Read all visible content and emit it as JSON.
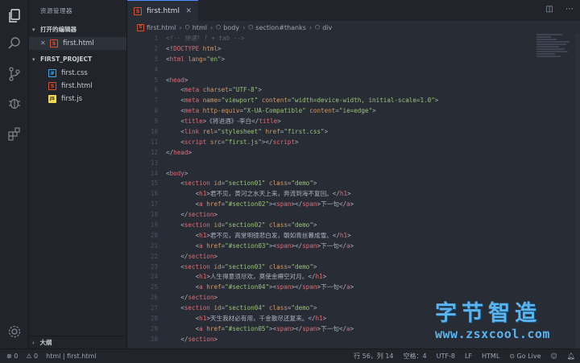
{
  "sidebar": {
    "title": "资源管理器",
    "open_editors": {
      "label": "打开的编辑器",
      "items": [
        {
          "close": "✕",
          "icon": "5",
          "name": "first.html"
        }
      ]
    },
    "project": {
      "label": "FIRST_PROJECT",
      "items": [
        {
          "icon": "#",
          "type": "css",
          "name": "first.css"
        },
        {
          "icon": "5",
          "type": "html",
          "name": "first.html"
        },
        {
          "icon": "JS",
          "type": "js",
          "name": "first.js"
        }
      ]
    },
    "outline_label": "大纲"
  },
  "tabs": [
    {
      "label": "first.html",
      "icon": "5",
      "close": "✕"
    }
  ],
  "breadcrumb": [
    "first.html",
    "html",
    "body",
    "section#thanks",
    "div"
  ],
  "editor": {
    "line_numbers": [
      "1",
      "2",
      "3",
      "4",
      "5",
      "6",
      "7",
      "8",
      "9",
      "10",
      "11",
      "12",
      "13",
      "14",
      "15",
      "16",
      "17",
      "18",
      "19",
      "20",
      "21",
      "22",
      "23",
      "24",
      "25",
      "26",
      "27",
      "28",
      "29",
      "30"
    ],
    "lines": [
      [
        {
          "c": "t-cmt",
          "t": "<!-- 快速! ! + tab -->"
        }
      ],
      [
        {
          "c": "t-punc",
          "t": "<!"
        },
        {
          "c": "t-tag",
          "t": "DOCTYPE"
        },
        {
          "c": "t-attr",
          "t": " html"
        },
        {
          "c": "t-punc",
          "t": ">"
        }
      ],
      [
        {
          "c": "t-punc",
          "t": "<"
        },
        {
          "c": "t-tag",
          "t": "html"
        },
        {
          "c": "t-attr",
          "t": " lang"
        },
        {
          "c": "t-punc",
          "t": "="
        },
        {
          "c": "t-str",
          "t": "\"en\""
        },
        {
          "c": "t-punc",
          "t": ">"
        }
      ],
      [],
      [
        {
          "c": "t-punc",
          "t": "<"
        },
        {
          "c": "t-tag",
          "t": "head"
        },
        {
          "c": "t-punc",
          "t": ">"
        }
      ],
      [
        {
          "c": "t-punc",
          "t": "    <"
        },
        {
          "c": "t-tag",
          "t": "meta"
        },
        {
          "c": "t-attr",
          "t": " charset"
        },
        {
          "c": "t-punc",
          "t": "="
        },
        {
          "c": "t-str",
          "t": "\"UTF-8\""
        },
        {
          "c": "t-punc",
          "t": ">"
        }
      ],
      [
        {
          "c": "t-punc",
          "t": "    <"
        },
        {
          "c": "t-tag",
          "t": "meta"
        },
        {
          "c": "t-attr",
          "t": " name"
        },
        {
          "c": "t-punc",
          "t": "="
        },
        {
          "c": "t-str",
          "t": "\"viewport\""
        },
        {
          "c": "t-attr",
          "t": " content"
        },
        {
          "c": "t-punc",
          "t": "="
        },
        {
          "c": "t-str",
          "t": "\"width=device-width, initial-scale=1.0\""
        },
        {
          "c": "t-punc",
          "t": ">"
        }
      ],
      [
        {
          "c": "t-punc",
          "t": "    <"
        },
        {
          "c": "t-tag",
          "t": "meta"
        },
        {
          "c": "t-attr",
          "t": " http-equiv"
        },
        {
          "c": "t-punc",
          "t": "="
        },
        {
          "c": "t-str",
          "t": "\"X-UA-Compatible\""
        },
        {
          "c": "t-attr",
          "t": " content"
        },
        {
          "c": "t-punc",
          "t": "="
        },
        {
          "c": "t-str",
          "t": "\"ie=edge\""
        },
        {
          "c": "t-punc",
          "t": ">"
        }
      ],
      [
        {
          "c": "t-punc",
          "t": "    <"
        },
        {
          "c": "t-tag",
          "t": "title"
        },
        {
          "c": "t-punc",
          "t": ">"
        },
        {
          "c": "t-cjk",
          "t": "《将进酒》-李白"
        },
        {
          "c": "t-punc",
          "t": "</"
        },
        {
          "c": "t-tag",
          "t": "title"
        },
        {
          "c": "t-punc",
          "t": ">"
        }
      ],
      [
        {
          "c": "t-punc",
          "t": "    <"
        },
        {
          "c": "t-tag",
          "t": "link"
        },
        {
          "c": "t-attr",
          "t": " rel"
        },
        {
          "c": "t-punc",
          "t": "="
        },
        {
          "c": "t-str",
          "t": "\"stylesheet\""
        },
        {
          "c": "t-attr",
          "t": " href"
        },
        {
          "c": "t-punc",
          "t": "="
        },
        {
          "c": "t-str",
          "t": "\"first.css\""
        },
        {
          "c": "t-punc",
          "t": ">"
        }
      ],
      [
        {
          "c": "t-punc",
          "t": "    <"
        },
        {
          "c": "t-tag",
          "t": "script"
        },
        {
          "c": "t-attr",
          "t": " src"
        },
        {
          "c": "t-punc",
          "t": "="
        },
        {
          "c": "t-str",
          "t": "\"first.js\""
        },
        {
          "c": "t-punc",
          "t": "></"
        },
        {
          "c": "t-tag",
          "t": "script"
        },
        {
          "c": "t-punc",
          "t": ">"
        }
      ],
      [
        {
          "c": "t-punc",
          "t": "</"
        },
        {
          "c": "t-tag",
          "t": "head"
        },
        {
          "c": "t-punc",
          "t": ">"
        }
      ],
      [],
      [
        {
          "c": "t-punc",
          "t": "<"
        },
        {
          "c": "t-tag",
          "t": "body"
        },
        {
          "c": "t-punc",
          "t": ">"
        }
      ],
      [
        {
          "c": "t-punc",
          "t": "    <"
        },
        {
          "c": "t-tag",
          "t": "section"
        },
        {
          "c": "t-attr",
          "t": " id"
        },
        {
          "c": "t-punc",
          "t": "="
        },
        {
          "c": "t-str",
          "t": "\"section01\""
        },
        {
          "c": "t-attr",
          "t": " class"
        },
        {
          "c": "t-punc",
          "t": "="
        },
        {
          "c": "t-str",
          "t": "\"demo\""
        },
        {
          "c": "t-punc",
          "t": ">"
        }
      ],
      [
        {
          "c": "t-punc",
          "t": "        <"
        },
        {
          "c": "t-tag",
          "t": "h1"
        },
        {
          "c": "t-punc",
          "t": ">"
        },
        {
          "c": "t-cjk",
          "t": "君不见，黄河之水天上来，奔流到海不复回。"
        },
        {
          "c": "t-punc",
          "t": "</"
        },
        {
          "c": "t-tag",
          "t": "h1"
        },
        {
          "c": "t-punc",
          "t": ">"
        }
      ],
      [
        {
          "c": "t-punc",
          "t": "        <"
        },
        {
          "c": "t-tag",
          "t": "a"
        },
        {
          "c": "t-attr",
          "t": " href"
        },
        {
          "c": "t-punc",
          "t": "="
        },
        {
          "c": "t-str",
          "t": "\"#section02\""
        },
        {
          "c": "t-punc",
          "t": "><"
        },
        {
          "c": "t-tag",
          "t": "span"
        },
        {
          "c": "t-punc",
          "t": "></"
        },
        {
          "c": "t-tag",
          "t": "span"
        },
        {
          "c": "t-punc",
          "t": ">"
        },
        {
          "c": "t-cjk",
          "t": "下一句"
        },
        {
          "c": "t-punc",
          "t": "</"
        },
        {
          "c": "t-tag",
          "t": "a"
        },
        {
          "c": "t-punc",
          "t": ">"
        }
      ],
      [
        {
          "c": "t-punc",
          "t": "    </"
        },
        {
          "c": "t-tag",
          "t": "section"
        },
        {
          "c": "t-punc",
          "t": ">"
        }
      ],
      [
        {
          "c": "t-punc",
          "t": "    <"
        },
        {
          "c": "t-tag",
          "t": "section"
        },
        {
          "c": "t-attr",
          "t": " id"
        },
        {
          "c": "t-punc",
          "t": "="
        },
        {
          "c": "t-str",
          "t": "\"section02\""
        },
        {
          "c": "t-attr",
          "t": " class"
        },
        {
          "c": "t-punc",
          "t": "="
        },
        {
          "c": "t-str",
          "t": "\"demo\""
        },
        {
          "c": "t-punc",
          "t": ">"
        }
      ],
      [
        {
          "c": "t-punc",
          "t": "        <"
        },
        {
          "c": "t-tag",
          "t": "h1"
        },
        {
          "c": "t-punc",
          "t": ">"
        },
        {
          "c": "t-cjk",
          "t": "君不见，高堂明镜悲白发，朝如青丝暮成雪。"
        },
        {
          "c": "t-punc",
          "t": "</"
        },
        {
          "c": "t-tag",
          "t": "h1"
        },
        {
          "c": "t-punc",
          "t": ">"
        }
      ],
      [
        {
          "c": "t-punc",
          "t": "        <"
        },
        {
          "c": "t-tag",
          "t": "a"
        },
        {
          "c": "t-attr",
          "t": " href"
        },
        {
          "c": "t-punc",
          "t": "="
        },
        {
          "c": "t-str",
          "t": "\"#section03\""
        },
        {
          "c": "t-punc",
          "t": "><"
        },
        {
          "c": "t-tag",
          "t": "span"
        },
        {
          "c": "t-punc",
          "t": "></"
        },
        {
          "c": "t-tag",
          "t": "span"
        },
        {
          "c": "t-punc",
          "t": ">"
        },
        {
          "c": "t-cjk",
          "t": "下一句"
        },
        {
          "c": "t-punc",
          "t": "</"
        },
        {
          "c": "t-tag",
          "t": "a"
        },
        {
          "c": "t-punc",
          "t": ">"
        }
      ],
      [
        {
          "c": "t-punc",
          "t": "    </"
        },
        {
          "c": "t-tag",
          "t": "section"
        },
        {
          "c": "t-punc",
          "t": ">"
        }
      ],
      [
        {
          "c": "t-punc",
          "t": "    <"
        },
        {
          "c": "t-tag",
          "t": "section"
        },
        {
          "c": "t-attr",
          "t": " id"
        },
        {
          "c": "t-punc",
          "t": "="
        },
        {
          "c": "t-str",
          "t": "\"section03\""
        },
        {
          "c": "t-attr",
          "t": " class"
        },
        {
          "c": "t-punc",
          "t": "="
        },
        {
          "c": "t-str",
          "t": "\"demo\""
        },
        {
          "c": "t-punc",
          "t": ">"
        }
      ],
      [
        {
          "c": "t-punc",
          "t": "        <"
        },
        {
          "c": "t-tag",
          "t": "h1"
        },
        {
          "c": "t-punc",
          "t": ">"
        },
        {
          "c": "t-cjk",
          "t": "人生得意须尽欢，莫使金樽空对月。"
        },
        {
          "c": "t-punc",
          "t": "</"
        },
        {
          "c": "t-tag",
          "t": "h1"
        },
        {
          "c": "t-punc",
          "t": ">"
        }
      ],
      [
        {
          "c": "t-punc",
          "t": "        <"
        },
        {
          "c": "t-tag",
          "t": "a"
        },
        {
          "c": "t-attr",
          "t": " href"
        },
        {
          "c": "t-punc",
          "t": "="
        },
        {
          "c": "t-str",
          "t": "\"#section04\""
        },
        {
          "c": "t-punc",
          "t": "><"
        },
        {
          "c": "t-tag",
          "t": "span"
        },
        {
          "c": "t-punc",
          "t": "></"
        },
        {
          "c": "t-tag",
          "t": "span"
        },
        {
          "c": "t-punc",
          "t": ">"
        },
        {
          "c": "t-cjk",
          "t": "下一句"
        },
        {
          "c": "t-punc",
          "t": "</"
        },
        {
          "c": "t-tag",
          "t": "a"
        },
        {
          "c": "t-punc",
          "t": ">"
        }
      ],
      [
        {
          "c": "t-punc",
          "t": "    </"
        },
        {
          "c": "t-tag",
          "t": "section"
        },
        {
          "c": "t-punc",
          "t": ">"
        }
      ],
      [
        {
          "c": "t-punc",
          "t": "    <"
        },
        {
          "c": "t-tag",
          "t": "section"
        },
        {
          "c": "t-attr",
          "t": " id"
        },
        {
          "c": "t-punc",
          "t": "="
        },
        {
          "c": "t-str",
          "t": "\"section04\""
        },
        {
          "c": "t-attr",
          "t": " class"
        },
        {
          "c": "t-punc",
          "t": "="
        },
        {
          "c": "t-str",
          "t": "\"demo\""
        },
        {
          "c": "t-punc",
          "t": ">"
        }
      ],
      [
        {
          "c": "t-punc",
          "t": "        <"
        },
        {
          "c": "t-tag",
          "t": "h1"
        },
        {
          "c": "t-punc",
          "t": ">"
        },
        {
          "c": "t-cjk",
          "t": "天生我材必有用，千金散尽还复来。"
        },
        {
          "c": "t-punc",
          "t": "</"
        },
        {
          "c": "t-tag",
          "t": "h1"
        },
        {
          "c": "t-punc",
          "t": ">"
        }
      ],
      [
        {
          "c": "t-punc",
          "t": "        <"
        },
        {
          "c": "t-tag",
          "t": "a"
        },
        {
          "c": "t-attr",
          "t": " href"
        },
        {
          "c": "t-punc",
          "t": "="
        },
        {
          "c": "t-str",
          "t": "\"#section05\""
        },
        {
          "c": "t-punc",
          "t": "><"
        },
        {
          "c": "t-tag",
          "t": "span"
        },
        {
          "c": "t-punc",
          "t": "></"
        },
        {
          "c": "t-tag",
          "t": "span"
        },
        {
          "c": "t-punc",
          "t": ">"
        },
        {
          "c": "t-cjk",
          "t": "下一句"
        },
        {
          "c": "t-punc",
          "t": "</"
        },
        {
          "c": "t-tag",
          "t": "a"
        },
        {
          "c": "t-punc",
          "t": ">"
        }
      ],
      [
        {
          "c": "t-punc",
          "t": "    </"
        },
        {
          "c": "t-tag",
          "t": "section"
        },
        {
          "c": "t-punc",
          "t": ">"
        }
      ]
    ]
  },
  "watermark": {
    "title": "字节智造",
    "url": "www.zsxcool.com"
  },
  "status": {
    "errors": "⊗ 0",
    "warnings": "⚠ 0",
    "path": "html | first.html",
    "position": "行 56，列 14",
    "spaces": "空格：4",
    "encoding": "UTF-8",
    "eol": "LF",
    "language": "HTML",
    "golive": "⊙ Go Live"
  },
  "colors": {
    "accent": "#528bff",
    "watermark": "#5ab4f0"
  }
}
